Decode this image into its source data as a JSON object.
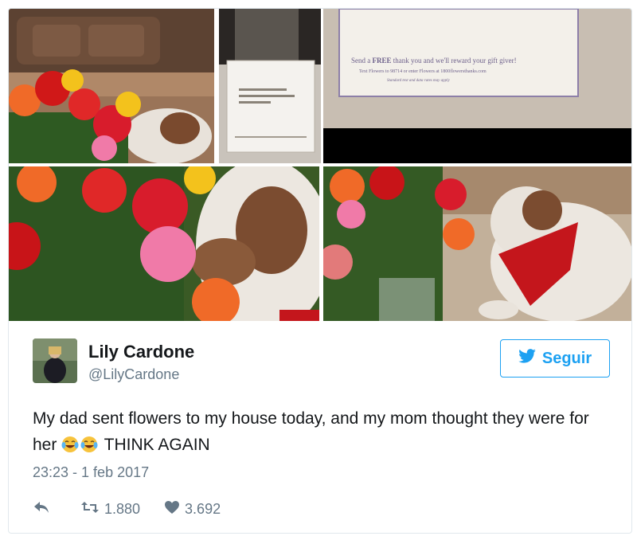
{
  "tweet": {
    "author_name": "Lily Cardone",
    "author_handle": "@LilyCardone",
    "follow_label": "Seguir",
    "text_before_emoji": "My dad sent flowers to my house today, and my mom thought they were for her",
    "emoji": [
      "face-with-tears-of-joy",
      "face-with-tears-of-joy"
    ],
    "text_after_emoji": "THINK AGAIN",
    "timestamp": "23:23 - 1 feb 2017",
    "retweet_count": "1.880",
    "like_count": "3.692"
  },
  "photo_card": {
    "line1_prefix": "Send a",
    "line1_em": "FREE",
    "line1_rest": "thank you and we'll reward your gift giver!",
    "line2": "Text Flowers to 98714 or enter Flowers at 1800flowersthanks.com",
    "line3": "Standard text and data rates may apply"
  },
  "icons": {
    "reply": "reply-icon",
    "retweet": "retweet-icon",
    "like": "heart-icon",
    "follow": "twitter-bird-icon"
  },
  "colors": {
    "brand": "#1da1f2",
    "muted": "#657786",
    "text": "#14171a"
  }
}
